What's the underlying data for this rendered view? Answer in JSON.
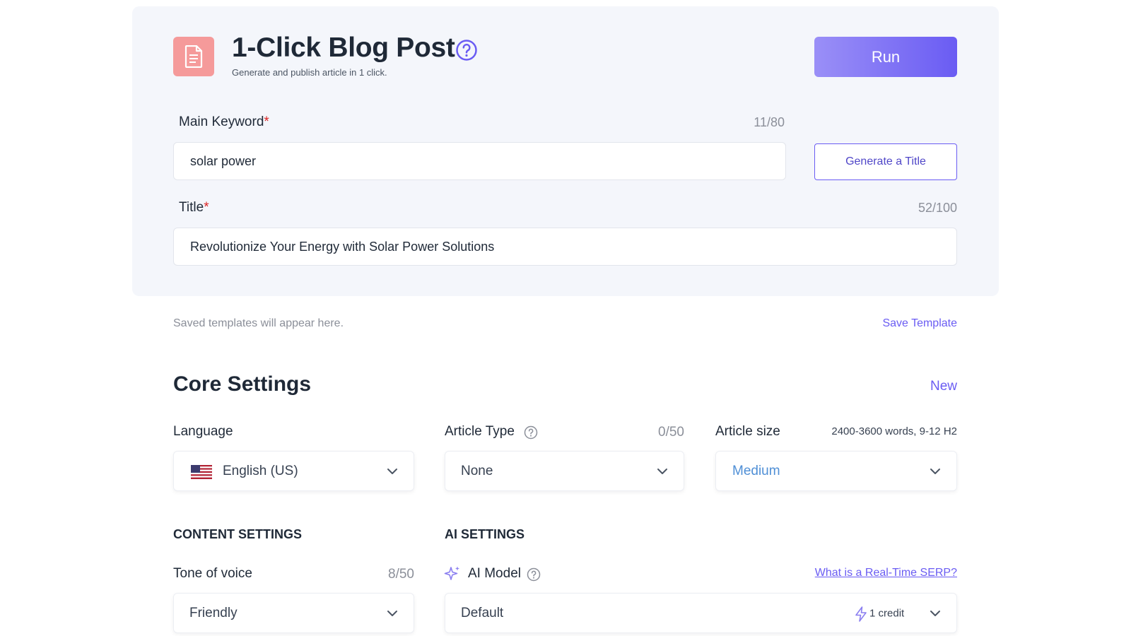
{
  "header": {
    "title": "1-Click Blog Post",
    "subtitle": "Generate and publish article in 1 click.",
    "run_label": "Run"
  },
  "main_keyword": {
    "label": "Main Keyword",
    "required_mark": "*",
    "counter": "11/80",
    "value": "solar power",
    "generate_label": "Generate a Title"
  },
  "title_field": {
    "label": "Title",
    "required_mark": "*",
    "counter": "52/100",
    "value": "Revolutionize Your Energy with Solar Power Solutions"
  },
  "templates": {
    "empty_text": "Saved templates will appear here.",
    "save_label": "Save Template"
  },
  "core_settings": {
    "title": "Core Settings",
    "new_label": "New",
    "language": {
      "label": "Language",
      "value": "English (US)"
    },
    "article_type": {
      "label": "Article Type",
      "counter": "0/50",
      "value": "None"
    },
    "article_size": {
      "label": "Article size",
      "info": "2400-3600 words, 9-12 H2",
      "value": "Medium"
    }
  },
  "content_settings": {
    "heading": "CONTENT SETTINGS",
    "tone": {
      "label": "Tone of voice",
      "counter": "8/50",
      "value": "Friendly"
    }
  },
  "ai_settings": {
    "heading": "AI SETTINGS",
    "model": {
      "label": "AI Model",
      "link": "What is a Real-Time SERP?",
      "value": "Default",
      "credit": "1 credit"
    }
  },
  "colors": {
    "accent": "#6a5cf3",
    "icon_box": "#f59a9a",
    "required": "#dc2626",
    "card_bg": "#f4f6fb"
  },
  "icons": [
    "document-icon",
    "help-icon",
    "us-flag-icon",
    "chevron-down-icon",
    "sparkle-icon",
    "lightning-icon"
  ]
}
